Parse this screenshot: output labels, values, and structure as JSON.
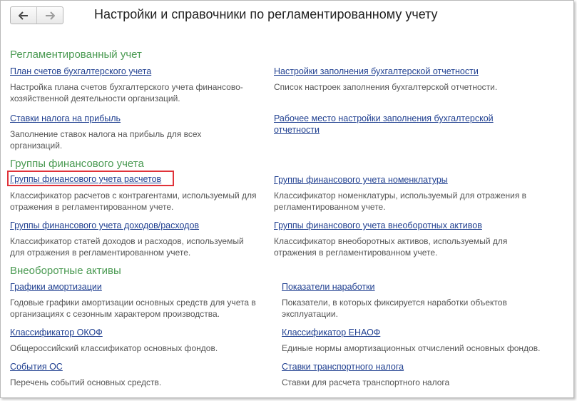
{
  "window": {
    "title": "Настройки и справочники по регламентированному учету"
  },
  "nav": {
    "back_icon": "arrow-left-icon",
    "forward_icon": "arrow-right-icon"
  },
  "sections": [
    {
      "title": "Регламентированный учет",
      "items": [
        {
          "link": "План счетов бухгалтерского учета",
          "desc": "Настройка плана счетов бухгалтерского учета финансово-хозяйственной деятельности организаций."
        },
        {
          "link": "Настройки заполнения бухгалтерской отчетности",
          "desc": "Список настроек заполнения бухгалтерской отчетности."
        },
        {
          "link": "Ставки налога на прибыль",
          "desc": "Заполнение ставок налога на прибыль для всех организаций."
        },
        {
          "link": "Рабочее место настройки заполнения бухгалтерской отчетности",
          "desc": ""
        }
      ]
    },
    {
      "title": "Группы финансового учета",
      "items": [
        {
          "link": "Группы финансового учета расчетов",
          "desc": "Классификатор расчетов с контрагентами, используемый для отражения в регламентированном учете."
        },
        {
          "link": "Группы финансового учета номенклатуры",
          "desc": "Классификатор номенклатуры, используемый для отражения в регламентированном учете."
        },
        {
          "link": "Группы финансового учета доходов/расходов",
          "desc": "Классификатор статей доходов и расходов, используемый для отражения в регламентированном учете."
        },
        {
          "link": "Группы финансового учета внеоборотных активов",
          "desc": "Классификатор внеоборотных активов, используемый для отражения в регламентированном учете."
        }
      ]
    },
    {
      "title": "Внеоборотные активы",
      "items": [
        {
          "link": "Графики амортизации",
          "desc": "Годовые графики амортизации основных средств для учета в организациях с сезонным характером производства."
        },
        {
          "link": "Показатели наработки",
          "desc": "Показатели, в которых фиксируется наработки объектов эксплуатации."
        },
        {
          "link": "Классификатор ОКОФ",
          "desc": "Общероссийский классификатор основных фондов."
        },
        {
          "link": "Классификатор ЕНАОФ",
          "desc": "Единые нормы амортизационных отчислений основных фондов."
        },
        {
          "link": "События ОС",
          "desc": "Перечень событий основных средств."
        },
        {
          "link": "Ставки транспортного налога",
          "desc": "Ставки для расчета транспортного налога"
        }
      ]
    }
  ],
  "highlighted_item": "Группы финансового учета расчетов",
  "colors": {
    "section_title": "#4a9a52",
    "link": "#1f3f90",
    "description": "#555555",
    "highlight": "#e0333a"
  }
}
